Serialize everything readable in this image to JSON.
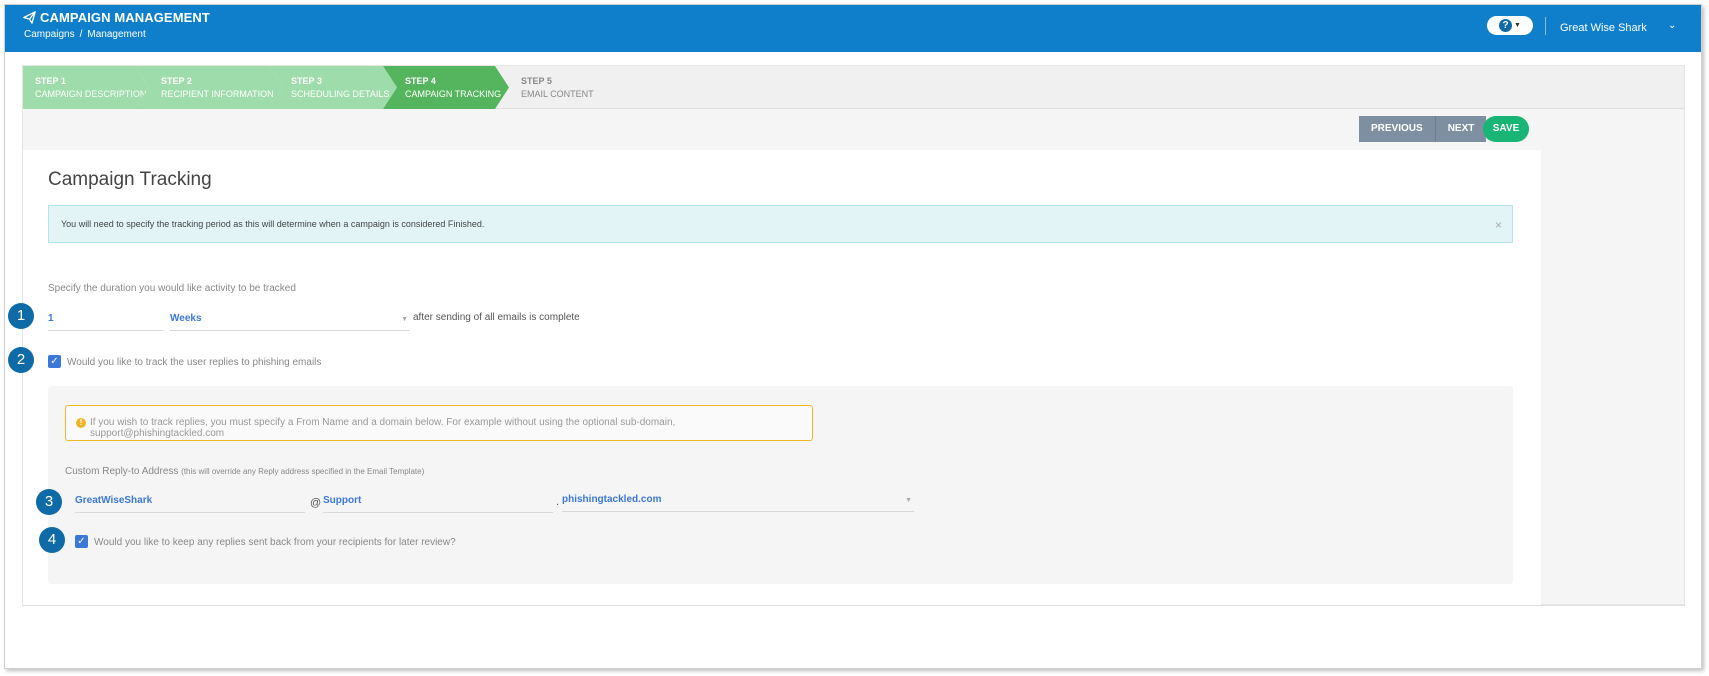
{
  "header": {
    "app_title": "CAMPAIGN MANAGEMENT",
    "breadcrumb": [
      "Campaigns",
      "/",
      "Management"
    ],
    "help_symbol": "?",
    "user_name": "Great Wise Shark",
    "brand_color": "#0f7fcb"
  },
  "steps": [
    {
      "num": "STEP 1",
      "label": "CAMPAIGN DESCRIPTION",
      "state": "done"
    },
    {
      "num": "STEP 2",
      "label": "RECIPIENT INFORMATION",
      "state": "done"
    },
    {
      "num": "STEP 3",
      "label": "SCHEDULING DETAILS",
      "state": "done"
    },
    {
      "num": "STEP 4",
      "label": "CAMPAIGN TRACKING",
      "state": "active"
    },
    {
      "num": "STEP 5",
      "label": "EMAIL CONTENT",
      "state": "todo"
    }
  ],
  "toolbar": {
    "previous_label": "PREVIOUS",
    "next_label": "NEXT",
    "save_label": "SAVE"
  },
  "main": {
    "title": "Campaign Tracking",
    "info_alert": "You will need to specify the tracking period as this will determine when a campaign is considered Finished.",
    "close_symbol": "×",
    "duration_label": "Specify the duration you would like activity to be tracked",
    "duration_value": "1",
    "duration_unit": "Weeks",
    "duration_suffix": "after sending of all emails is complete",
    "track_replies_label": "Would you like to track the user replies to phishing emails",
    "track_replies_checked": true,
    "warning_text": "If you wish to track replies, you must specify a From Name and a domain below. For example without using the optional sub-domain, support@phishingtackled.com",
    "reply_to_label": "Custom Reply-to Address",
    "reply_to_note": "(this will override any Reply address specified in the Email Template)",
    "reply_name": "GreatWiseShark",
    "at_symbol": "@",
    "reply_subdomain": "Support",
    "dot_symbol": ".",
    "reply_domain": "phishingtackled.com",
    "keep_replies_label": "Would you like to keep any replies sent back from your recipients for later review?",
    "keep_replies_checked": true
  },
  "callouts": [
    "1",
    "2",
    "3",
    "4"
  ]
}
